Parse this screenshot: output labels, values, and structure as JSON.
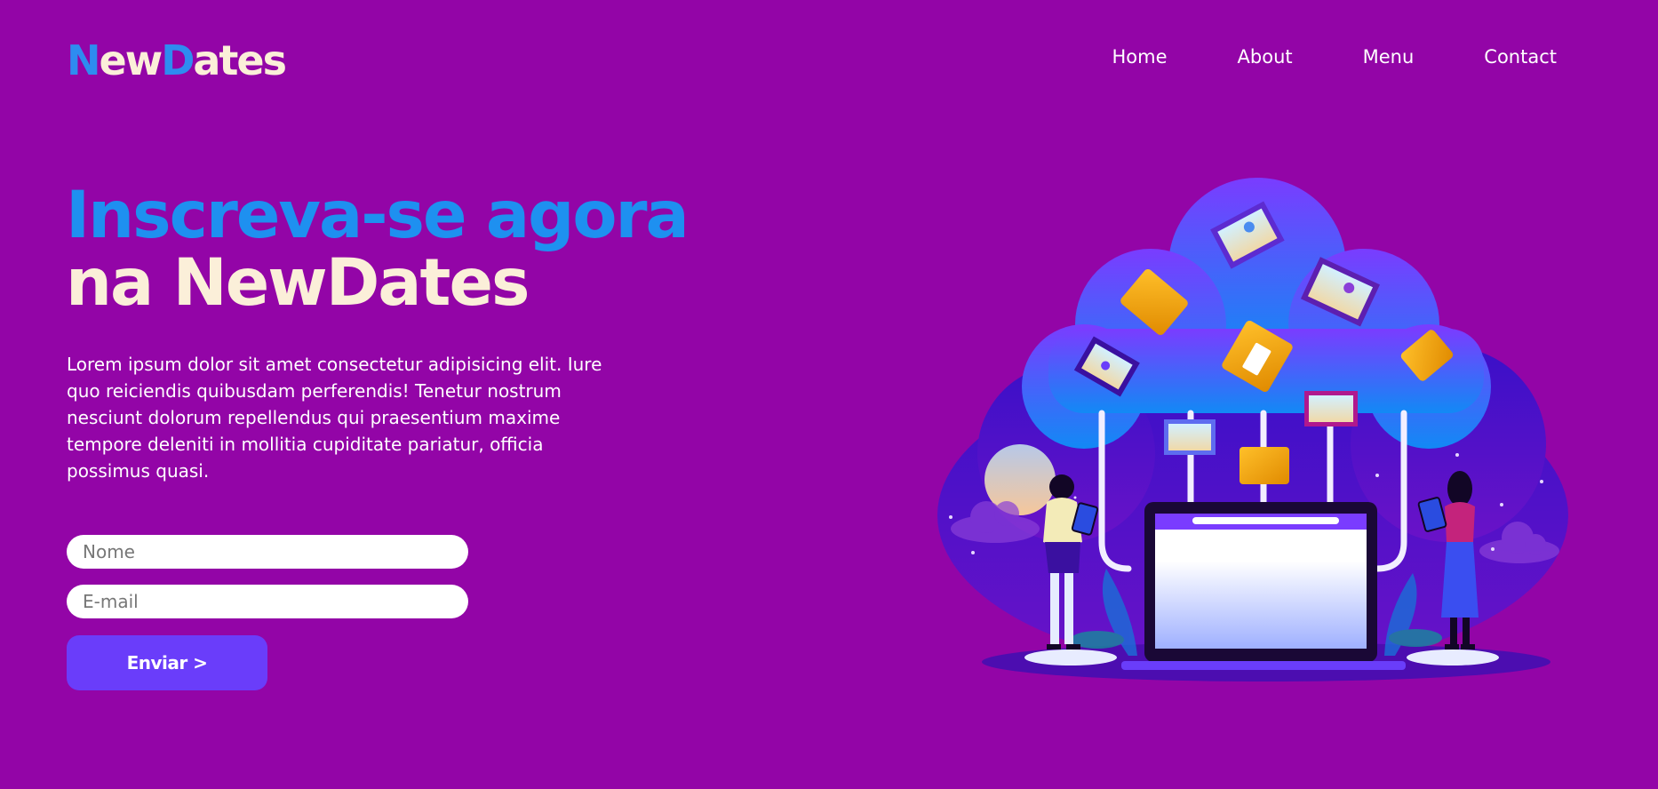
{
  "brand": {
    "part1": "N",
    "part2": "ew",
    "part3": "D",
    "part4": "ates"
  },
  "nav": {
    "items": [
      {
        "label": "Home"
      },
      {
        "label": "About"
      },
      {
        "label": "Menu"
      },
      {
        "label": "Contact"
      }
    ]
  },
  "hero": {
    "title_line1": "Inscreva-se agora",
    "title_line2": "na NewDates",
    "description": "Lorem ipsum dolor sit amet consectetur adipisicing elit. Iure quo reiciendis quibusdam perferendis! Tenetur nostrum nesciunt dolorum repellendus qui praesentium maxime tempore deleniti in mollitia cupiditate pariatur, officia possimus quasi."
  },
  "form": {
    "name_placeholder": "Nome",
    "email_placeholder": "E-mail",
    "submit_label": "Enviar >"
  },
  "colors": {
    "background": "#9305a7",
    "accent_blue": "#1e90f0",
    "cream": "#fbefd9",
    "button": "#6a3dfa"
  },
  "illustration": {
    "icon": "cloud-storage-illustration"
  }
}
